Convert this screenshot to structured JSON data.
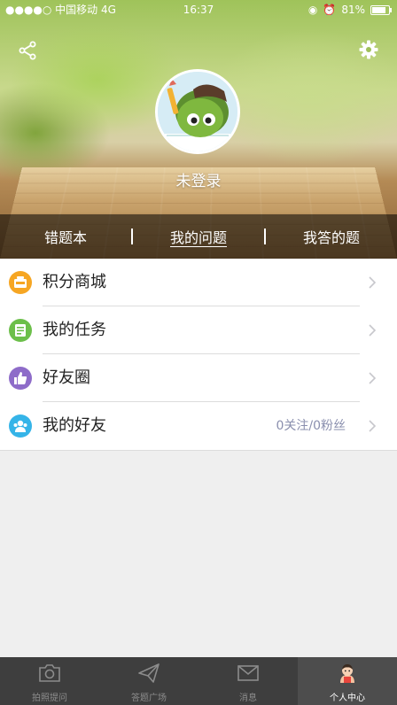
{
  "status_bar": {
    "carrier": "●●●●○ 中国移动  4G",
    "time": "16:37",
    "battery": "81%"
  },
  "header": {
    "login_text": "未登录",
    "tabs": [
      {
        "label": "错题本"
      },
      {
        "label": "我的问题"
      },
      {
        "label": "我答的题"
      }
    ]
  },
  "menu": {
    "items": [
      {
        "label": "积分商城",
        "icon": "store-icon",
        "color": "#f6a623"
      },
      {
        "label": "我的任务",
        "icon": "task-icon",
        "color": "#6cbf4a"
      },
      {
        "label": "好友圈",
        "icon": "thumbs-up-icon",
        "color": "#8e6cc9"
      },
      {
        "label": "我的好友",
        "icon": "friends-icon",
        "color": "#35b4e8",
        "extra": "0关注/0粉丝"
      }
    ]
  },
  "tabbar": {
    "items": [
      {
        "label": "拍照提问",
        "icon": "camera-icon"
      },
      {
        "label": "答题广场",
        "icon": "paper-plane-icon"
      },
      {
        "label": "消息",
        "icon": "mail-icon"
      },
      {
        "label": "个人中心",
        "icon": "person-icon",
        "active": true
      }
    ]
  }
}
